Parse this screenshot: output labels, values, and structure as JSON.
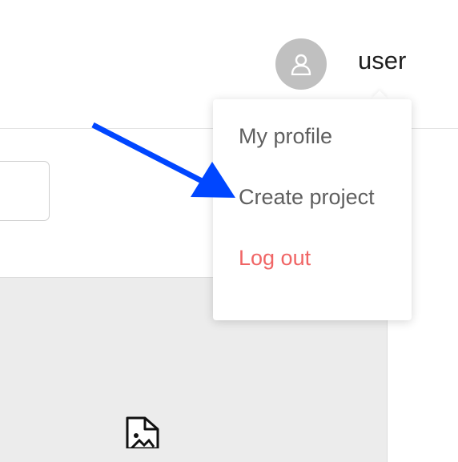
{
  "header": {
    "user": {
      "name": "user",
      "avatar_icon": "user-icon"
    }
  },
  "dropdown": {
    "items": [
      {
        "label": "My profile"
      },
      {
        "label": "Create project"
      },
      {
        "label": "Log out",
        "danger": true
      }
    ]
  },
  "content": {
    "placeholder_icon": "broken-image-file-icon"
  },
  "annotation": {
    "arrow_color": "#0046ff",
    "points_to": "Create project"
  },
  "colors": {
    "danger": "#f06565",
    "menu_text": "#5f5f5f",
    "avatar_bg": "#c0c0c0",
    "panel_bg": "#ececec"
  }
}
